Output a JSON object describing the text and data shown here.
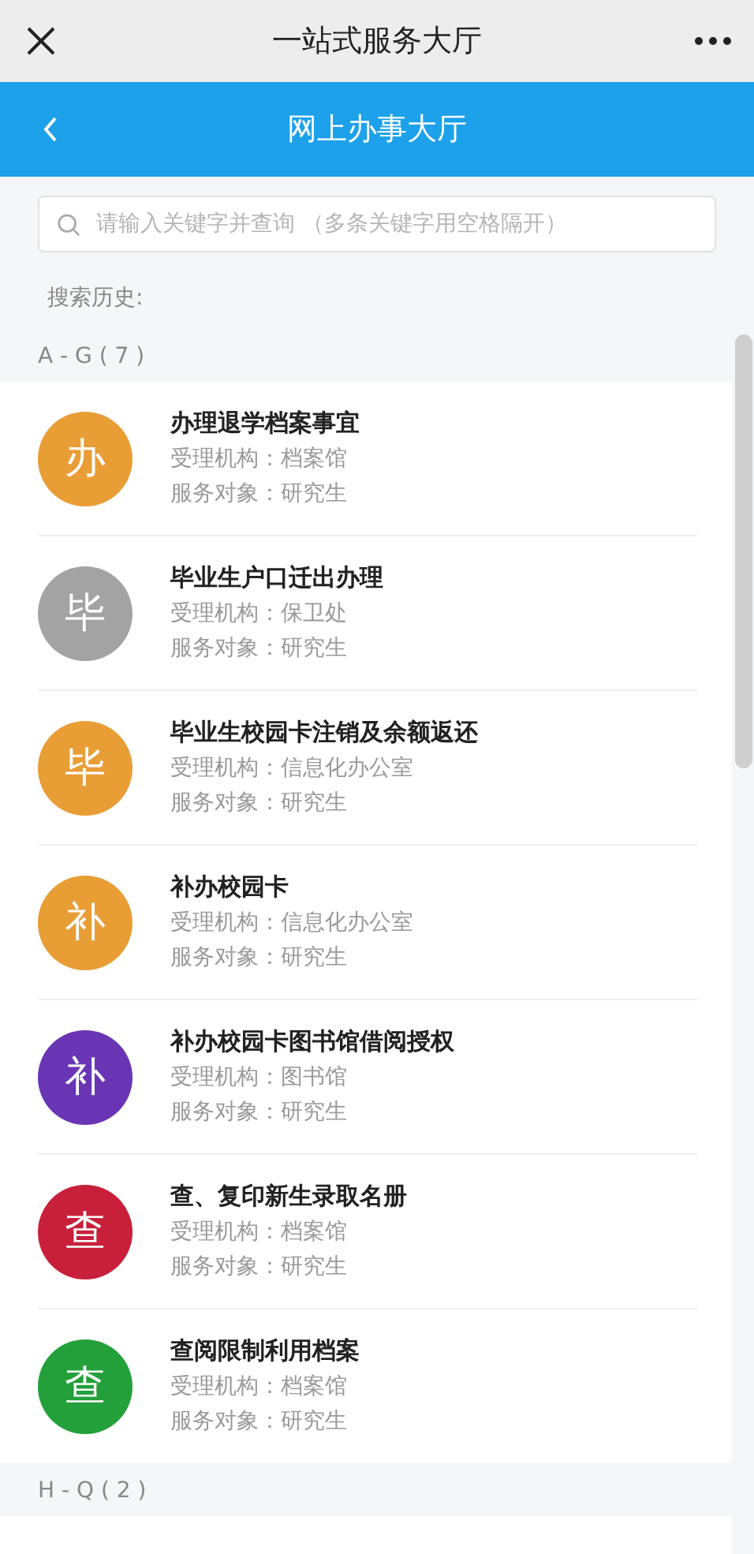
{
  "window": {
    "title": "一站式服务大厅"
  },
  "header": {
    "title": "网上办事大厅"
  },
  "search": {
    "placeholder": "请输入关键字并查询 （多条关键字用空格隔开）"
  },
  "history_label": "搜索历史:",
  "sections": [
    {
      "heading": "A - G ( 7 )",
      "items": [
        {
          "avatar": "办",
          "color": "#e99d35",
          "title": "办理退学档案事宜",
          "agency": "受理机构：档案馆",
          "audience": "服务对象：研究生"
        },
        {
          "avatar": "毕",
          "color": "#a3a3a3",
          "title": "毕业生户口迁出办理",
          "agency": "受理机构：保卫处",
          "audience": "服务对象：研究生"
        },
        {
          "avatar": "毕",
          "color": "#e99d35",
          "title": "毕业生校园卡注销及余额返还",
          "agency": "受理机构：信息化办公室",
          "audience": "服务对象：研究生"
        },
        {
          "avatar": "补",
          "color": "#e99d35",
          "title": "补办校园卡",
          "agency": "受理机构：信息化办公室",
          "audience": "服务对象：研究生"
        },
        {
          "avatar": "补",
          "color": "#6a35b5",
          "title": "补办校园卡图书馆借阅授权",
          "agency": "受理机构：图书馆",
          "audience": "服务对象：研究生"
        },
        {
          "avatar": "查",
          "color": "#c8203a",
          "title": "查、复印新生录取名册",
          "agency": "受理机构：档案馆",
          "audience": "服务对象：研究生"
        },
        {
          "avatar": "查",
          "color": "#23a03a",
          "title": "查阅限制利用档案",
          "agency": "受理机构：档案馆",
          "audience": "服务对象：研究生"
        }
      ]
    },
    {
      "heading": "H - Q ( 2 )"
    }
  ]
}
